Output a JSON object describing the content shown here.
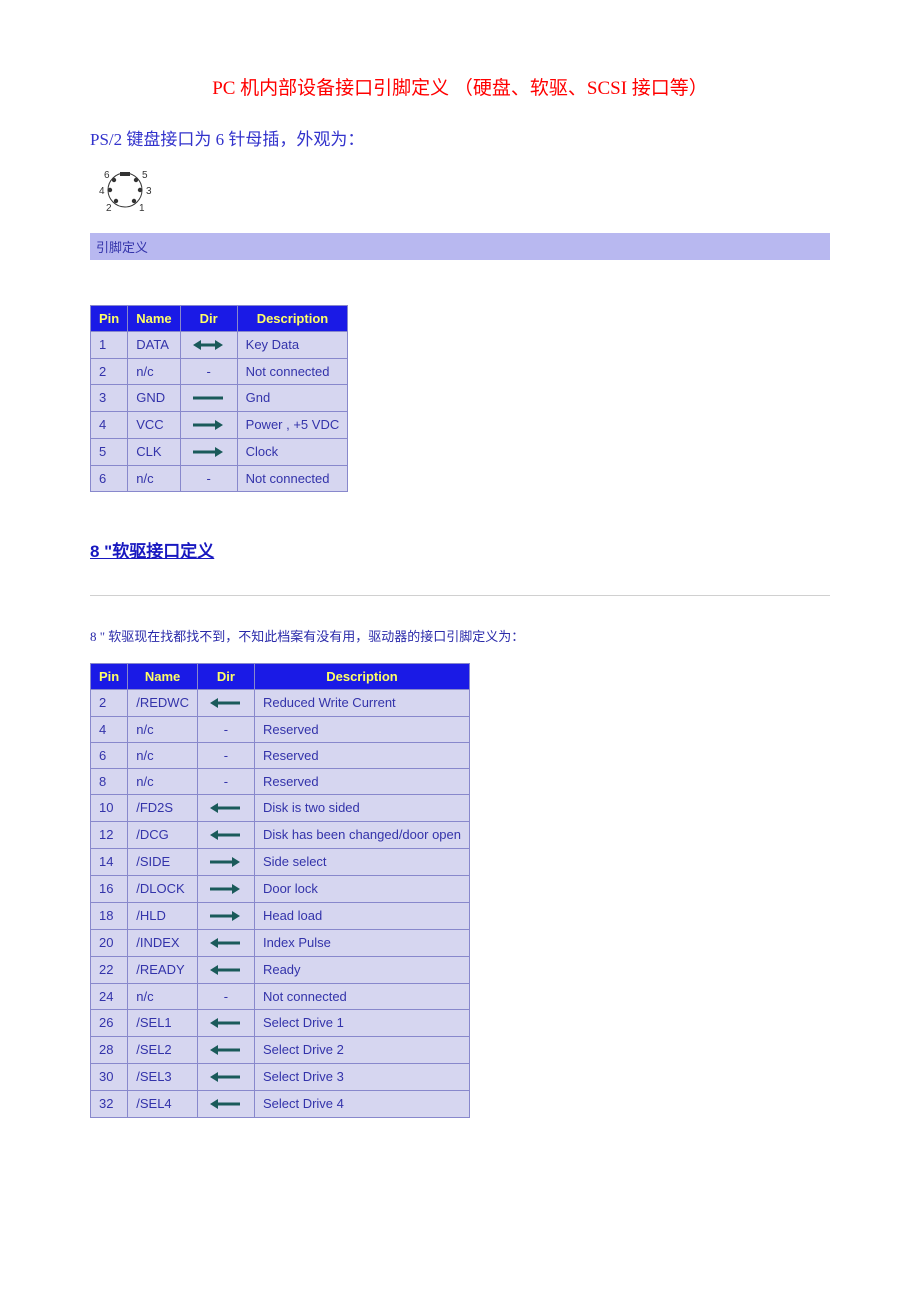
{
  "title": "PC 机内部设备接口引脚定义 （硬盘、软驱、SCSI 接口等）",
  "ps2": {
    "subtitle": "PS/2 键盘接口为 6 针母插，外观为：",
    "banner": "引脚定义",
    "headers": {
      "pin": "Pin",
      "name": "Name",
      "dir": "Dir",
      "desc": "Description"
    },
    "rows": [
      {
        "pin": "1",
        "name": "DATA",
        "dir": "both",
        "desc": "Key Data"
      },
      {
        "pin": "2",
        "name": "n/c",
        "dir": "none",
        "desc": "Not connected"
      },
      {
        "pin": "3",
        "name": "GND",
        "dir": "line",
        "desc": "Gnd"
      },
      {
        "pin": "4",
        "name": "VCC",
        "dir": "right",
        "desc": "Power , +5 VDC"
      },
      {
        "pin": "5",
        "name": "CLK",
        "dir": "right",
        "desc": "Clock"
      },
      {
        "pin": "6",
        "name": "n/c",
        "dir": "none",
        "desc": "Not connected"
      }
    ]
  },
  "floppy": {
    "link": "8 \"软驱接口定义",
    "note": "8 \" 软驱现在找都找不到，不知此档案有没有用，驱动器的接口引脚定义为：",
    "headers": {
      "pin": "Pin",
      "name": "Name",
      "dir": "Dir",
      "desc": "Description"
    },
    "rows": [
      {
        "pin": "2",
        "name": "/REDWC",
        "dir": "left",
        "desc": "Reduced Write Current"
      },
      {
        "pin": "4",
        "name": "n/c",
        "dir": "none",
        "desc": "Reserved"
      },
      {
        "pin": "6",
        "name": "n/c",
        "dir": "none",
        "desc": "Reserved"
      },
      {
        "pin": "8",
        "name": "n/c",
        "dir": "none",
        "desc": "Reserved"
      },
      {
        "pin": "10",
        "name": "/FD2S",
        "dir": "left",
        "desc": "Disk is two sided"
      },
      {
        "pin": "12",
        "name": "/DCG",
        "dir": "left",
        "desc": "Disk has been changed/door open"
      },
      {
        "pin": "14",
        "name": "/SIDE",
        "dir": "right",
        "desc": "Side select"
      },
      {
        "pin": "16",
        "name": "/DLOCK",
        "dir": "right",
        "desc": "Door lock"
      },
      {
        "pin": "18",
        "name": "/HLD",
        "dir": "right",
        "desc": "Head load"
      },
      {
        "pin": "20",
        "name": "/INDEX",
        "dir": "left",
        "desc": "Index Pulse"
      },
      {
        "pin": "22",
        "name": "/READY",
        "dir": "left",
        "desc": "Ready"
      },
      {
        "pin": "24",
        "name": "n/c",
        "dir": "none",
        "desc": "Not connected"
      },
      {
        "pin": "26",
        "name": "/SEL1",
        "dir": "left",
        "desc": "Select Drive 1"
      },
      {
        "pin": "28",
        "name": "/SEL2",
        "dir": "left",
        "desc": "Select Drive 2"
      },
      {
        "pin": "30",
        "name": "/SEL3",
        "dir": "left",
        "desc": "Select Drive 3"
      },
      {
        "pin": "32",
        "name": "/SEL4",
        "dir": "left",
        "desc": "Select Drive 4"
      }
    ]
  }
}
